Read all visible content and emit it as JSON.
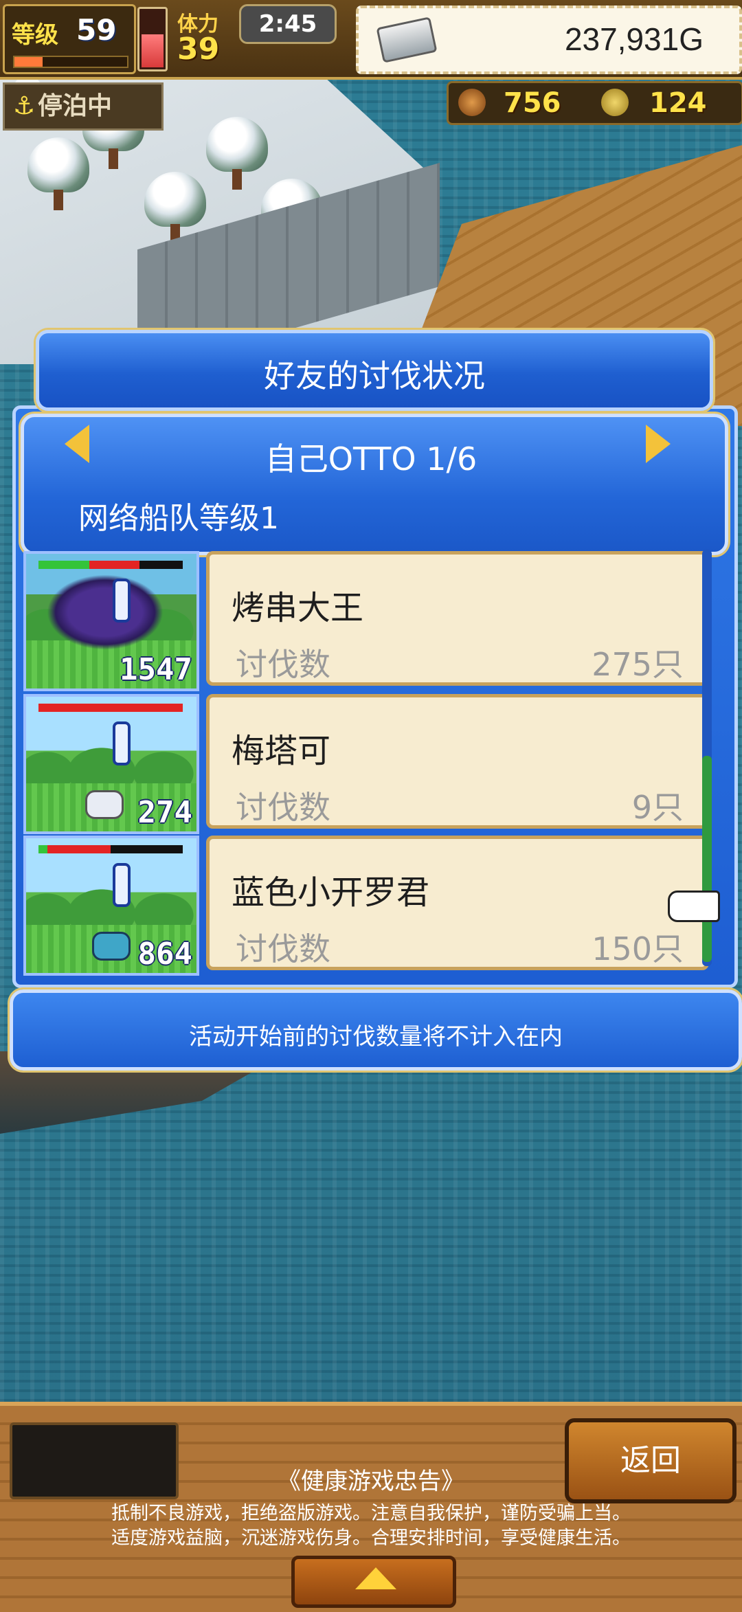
{
  "hud": {
    "level_label": "等级",
    "level_value": "59",
    "xp_fill": 0.25,
    "stamina_fill": 0.55,
    "stamina_label": "体力",
    "stamina_value": "39",
    "clock": "2:45",
    "gold": "237,931G",
    "status": "停泊中",
    "resource_a": "756",
    "resource_b": "124"
  },
  "dialog": {
    "title": "好友的讨伐状况",
    "page_label": "自己OTTO 1/6",
    "fleet_level": "网络船队等级1",
    "entries": [
      {
        "name": "烤串大王",
        "stat_label": "讨伐数",
        "stat_value": "275只",
        "thumb_count": "1547",
        "hp_fill": 0.7,
        "hp_green": 0.35
      },
      {
        "name": "梅塔可",
        "stat_label": "讨伐数",
        "stat_value": "9只",
        "thumb_count": "274",
        "hp_fill": 1.0,
        "hp_green": 0.0
      },
      {
        "name": "蓝色小开罗君",
        "stat_label": "讨伐数",
        "stat_value": "150只",
        "thumb_count": "864",
        "hp_fill": 0.5,
        "hp_green": 0.06
      }
    ],
    "note": "活动开始前的讨伐数量将不计入在内"
  },
  "bottom": {
    "back_label": "返回",
    "advisory_title": "《健康游戏忠告》",
    "advisory_line1": "抵制不良游戏，拒绝盗版游戏。注意自我保护，谨防受骗上当。",
    "advisory_line2": "适度游戏益脑，沉迷游戏伤身。合理安排时间，享受健康生活。"
  },
  "colors": {
    "dialog_blue": "#1f5fd0",
    "card_bg": "#f7ecd0",
    "gold_arrow": "#f3c23a",
    "hp_red": "#e32424",
    "level_yellow": "#ffe24a"
  }
}
